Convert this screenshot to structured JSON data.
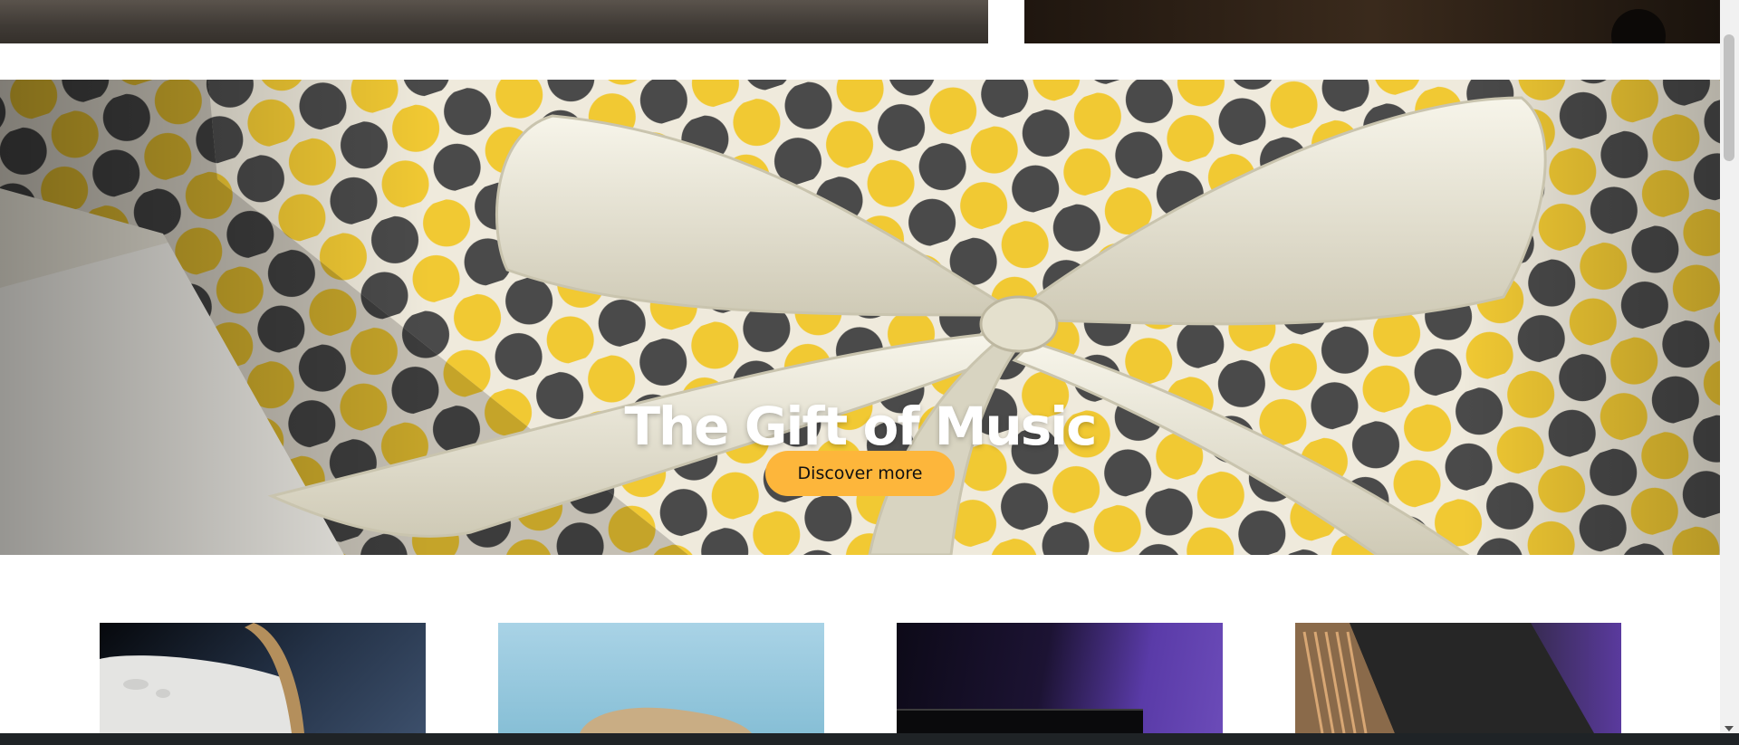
{
  "hero": {
    "title": "The Gift of Music",
    "cta_label": "Discover more"
  },
  "colors": {
    "cta_background": "#fdb63b",
    "wrap_yellow": "#f1c933",
    "wrap_gray": "#4a4a4a",
    "ribbon": "#e9e6d6"
  },
  "product_cards": [
    {
      "image": "headphones-white-image"
    },
    {
      "image": "headphones-beige-image"
    },
    {
      "image": "speaker-purple-image"
    },
    {
      "image": "soundbar-image"
    }
  ]
}
